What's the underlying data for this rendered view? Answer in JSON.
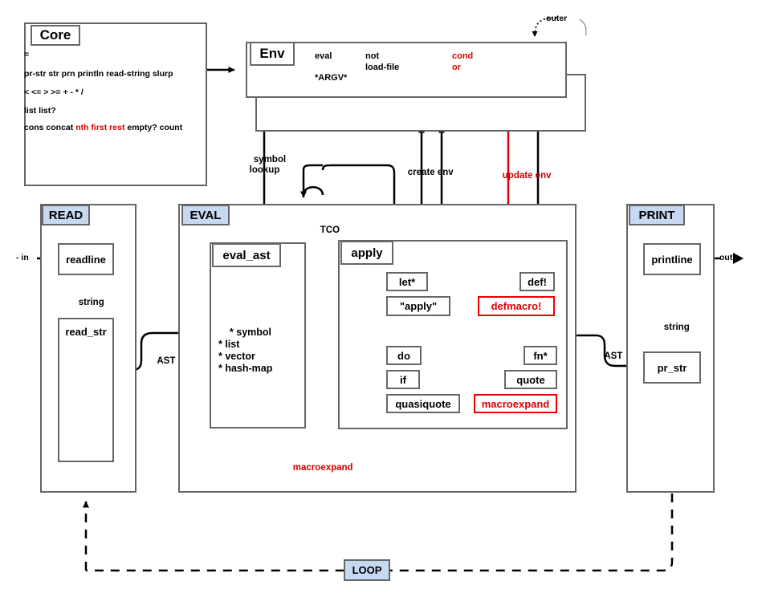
{
  "diagram": {
    "title": "MAL (Make A Lisp) step9 architecture diagram",
    "colors": {
      "phase_fill": "#c6d9f1",
      "box_stroke": "#666666",
      "accent_red": "#dd0000",
      "line_black": "#000000"
    }
  },
  "core": {
    "title": "Core",
    "lines": [
      {
        "parts": [
          {
            "text": "=",
            "color": "black"
          }
        ]
      },
      {
        "parts": [
          {
            "text": "pr-str str prn println read-string slurp",
            "color": "black"
          }
        ]
      },
      {
        "parts": [
          {
            "text": "< <= > >= + - * /",
            "color": "black"
          }
        ]
      },
      {
        "parts": [
          {
            "text": "list list?",
            "color": "black"
          }
        ]
      },
      {
        "parts": [
          {
            "text": "cons concat ",
            "color": "black"
          },
          {
            "text": "nth first rest",
            "color": "red"
          },
          {
            "text": " empty? count",
            "color": "black"
          }
        ]
      }
    ]
  },
  "env": {
    "title": "Env",
    "outer_label": "outer",
    "columns": [
      {
        "items": [
          {
            "text": "eval",
            "color": "black"
          },
          {
            "text": "*ARGV*",
            "color": "black"
          }
        ]
      },
      {
        "items": [
          {
            "text": "not",
            "color": "black"
          },
          {
            "text": "load-file",
            "color": "black"
          }
        ]
      },
      {
        "items": [
          {
            "text": "cond",
            "color": "red"
          },
          {
            "text": "or",
            "color": "red"
          }
        ]
      }
    ]
  },
  "read": {
    "phase": "READ",
    "in_label": "- in",
    "nodes": [
      {
        "id": "readline",
        "label": "readline"
      },
      {
        "id": "read_str",
        "label": "read_str"
      }
    ],
    "edges": [
      {
        "label": "string"
      },
      {
        "label": "AST"
      }
    ]
  },
  "eval": {
    "phase": "EVAL",
    "eval_ast": {
      "title": "eval_ast",
      "items": "* symbol\n* list\n* vector\n* hash-map"
    },
    "apply": {
      "title": "apply",
      "left_forms": [
        {
          "label": "let*",
          "red": false
        },
        {
          "label": "\"apply\"",
          "red": false
        },
        {
          "label": "do",
          "red": false
        },
        {
          "label": "if",
          "red": false
        },
        {
          "label": "quasiquote",
          "red": false
        }
      ],
      "right_forms": [
        {
          "label": "def!",
          "red": false
        },
        {
          "label": "defmacro!",
          "red": true
        },
        {
          "label": "fn*",
          "red": false
        },
        {
          "label": "quote",
          "red": false
        },
        {
          "label": "macroexpand",
          "red": true
        }
      ]
    },
    "labels": {
      "tco": "TCO",
      "macroexpand": "macroexpand",
      "symbol_lookup": "symbol\nlookup",
      "create_env": "create env",
      "update_env": "update env",
      "ast_out": "AST"
    }
  },
  "print": {
    "phase": "PRINT",
    "out_label": "out",
    "nodes": [
      {
        "id": "printline",
        "label": "printline"
      },
      {
        "id": "pr_str",
        "label": "pr_str"
      }
    ],
    "edges": [
      {
        "label": "string"
      }
    ]
  },
  "loop": {
    "label": "LOOP"
  }
}
